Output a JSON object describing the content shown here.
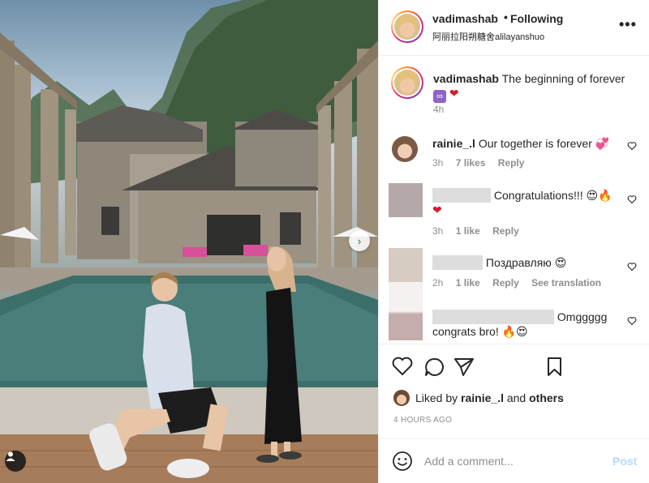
{
  "colors": {
    "accent": "#0095f6",
    "post_disabled": "#b3dbff",
    "muted": "#8e8e8e",
    "heart": "#d41b2c"
  },
  "header": {
    "username": "vadimashab",
    "separator": "•",
    "follow_label": "Following",
    "subtitle": "阿丽拉阳朔糖舍alilayanshuo",
    "more_icon": "more-dots-icon",
    "more_label": "•••"
  },
  "caption": {
    "username": "vadimashab",
    "text": "The beginning of forever",
    "emoji_infinity": "∞",
    "emoji_heart": "❤",
    "time": "4h"
  },
  "comments": [
    {
      "username": "rainie_.l",
      "text": "Our together is forever",
      "emoji": "💞",
      "time": "3h",
      "likes": "7 likes",
      "reply": "Reply"
    },
    {
      "username": "",
      "text": "Congratulations!!!",
      "emoji": "😍🔥",
      "emoji2": "❤",
      "time": "3h",
      "likes": "1 like",
      "reply": "Reply"
    },
    {
      "username": "",
      "text": "Поздравляю",
      "emoji": "😍",
      "time": "2h",
      "likes": "1 like",
      "reply": "Reply",
      "translate": "See translation"
    },
    {
      "username": "",
      "text": "Omggggg",
      "text2": "congrats bro!",
      "emoji": "🔥😍"
    }
  ],
  "likes": {
    "prefix": "Liked by",
    "user": "rainie_.l",
    "mid": "and",
    "others": "others",
    "ago": "4 HOURS AGO"
  },
  "add_comment": {
    "placeholder": "Add a comment...",
    "post_label": "Post"
  },
  "photo": {
    "next_label": "›"
  }
}
